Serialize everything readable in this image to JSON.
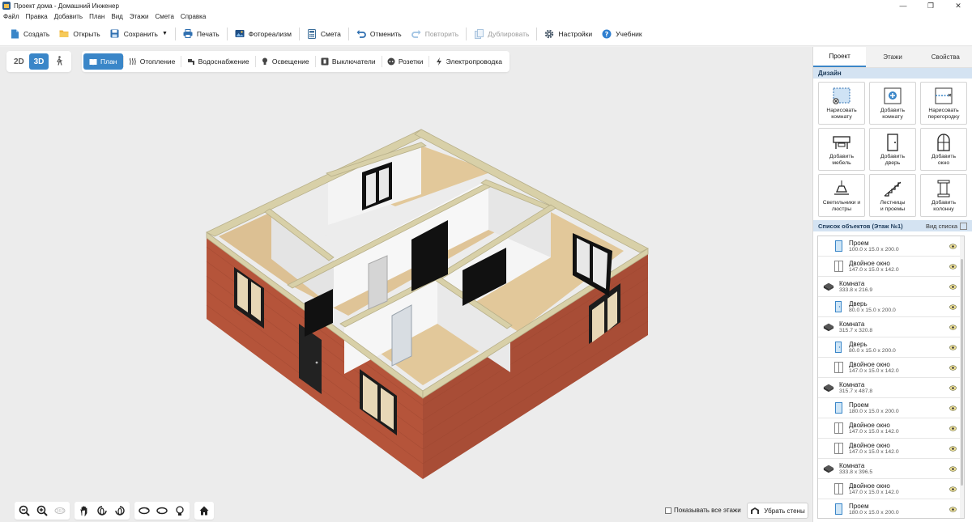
{
  "window": {
    "title": "Проект дома - Домашний Инженер",
    "controls": {
      "minimize": "—",
      "maximize": "❐",
      "close": "✕"
    }
  },
  "menu": [
    "Файл",
    "Правка",
    "Добавить",
    "План",
    "Вид",
    "Этажи",
    "Смета",
    "Справка"
  ],
  "toolbar": {
    "create": "Создать",
    "open": "Открыть",
    "save": "Сохранить",
    "print": "Печать",
    "photorealism": "Фотореализм",
    "estimate": "Смета",
    "undo": "Отменить",
    "redo": "Повторить",
    "duplicate": "Дублировать",
    "settings": "Настройки",
    "tutorial": "Учебник"
  },
  "view_toggle": {
    "mode_2d": "2D",
    "mode_3d": "3D",
    "active": "3D"
  },
  "layers": {
    "active": "plan",
    "items": {
      "plan": "План",
      "heating": "Отопление",
      "water": "Водоснабжение",
      "lighting": "Освещение",
      "switches": "Выключатели",
      "sockets": "Розетки",
      "wiring": "Электропроводка"
    }
  },
  "bottom": {
    "show_all_floors": "Показывать все этажи",
    "show_all_checked": false,
    "remove_walls": "Убрать стены",
    "tool_icons": [
      "zoom-out-icon",
      "zoom-in-icon",
      "rotate-360-icon",
      "pan-hand-icon",
      "rotate-left-icon",
      "rotate-right-icon",
      "tilt-up-icon",
      "tilt-down-icon",
      "light-bulb-icon",
      "home-icon"
    ]
  },
  "panel": {
    "tabs": {
      "project": "Проект",
      "floors": "Этажи",
      "properties": "Свойства",
      "active": "Проект"
    },
    "design_header": "Дизайн",
    "design_items": [
      {
        "label": "Нарисовать\nкомнату",
        "icon": "draw-room-icon"
      },
      {
        "label": "Добавить\nкомнату",
        "icon": "add-room-icon"
      },
      {
        "label": "Нарисовать\nперегородку",
        "icon": "draw-partition-icon"
      },
      {
        "label": "Добавить\nмебель",
        "icon": "furniture-icon"
      },
      {
        "label": "Добавить\nдверь",
        "icon": "door-icon"
      },
      {
        "label": "Добавить\nокно",
        "icon": "window-icon"
      },
      {
        "label": "Светильники и\nлюстры",
        "icon": "lamp-icon"
      },
      {
        "label": "Лестницы\nи проемы",
        "icon": "stairs-icon"
      },
      {
        "label": "Добавить\nколонну",
        "icon": "column-icon"
      }
    ],
    "list_header": "Список объектов (Этаж №1)",
    "list_view": "Вид списка",
    "objects": [
      {
        "name": "Проем",
        "dims": "100.0 x 15.0 x 200.0",
        "type": "opening",
        "child": true
      },
      {
        "name": "Двойное окно",
        "dims": "147.0 x 15.0 x 142.0",
        "type": "window",
        "child": true
      },
      {
        "name": "Комната",
        "dims": "333.8 x 216.9",
        "type": "room",
        "child": false
      },
      {
        "name": "Дверь",
        "dims": "80.0 x 15.0 x 200.0",
        "type": "door",
        "child": true
      },
      {
        "name": "Комната",
        "dims": "315.7 x 320.8",
        "type": "room",
        "child": false
      },
      {
        "name": "Дверь",
        "dims": "80.0 x 15.0 x 200.0",
        "type": "door",
        "child": true
      },
      {
        "name": "Двойное окно",
        "dims": "147.0 x 15.0 x 142.0",
        "type": "window",
        "child": true
      },
      {
        "name": "Комната",
        "dims": "315.7 x 487.8",
        "type": "room",
        "child": false
      },
      {
        "name": "Проем",
        "dims": "180.0 x 15.0 x 200.0",
        "type": "opening",
        "child": true
      },
      {
        "name": "Двойное окно",
        "dims": "147.0 x 15.0 x 142.0",
        "type": "window",
        "child": true
      },
      {
        "name": "Двойное окно",
        "dims": "147.0 x 15.0 x 142.0",
        "type": "window",
        "child": true
      },
      {
        "name": "Комната",
        "dims": "333.8 x 396.5",
        "type": "room",
        "child": false
      },
      {
        "name": "Двойное окно",
        "dims": "147.0 x 15.0 x 142.0",
        "type": "window",
        "child": true
      },
      {
        "name": "Проем",
        "dims": "180.0 x 15.0 x 200.0",
        "type": "opening",
        "child": true
      }
    ]
  },
  "colors": {
    "accent": "#3a86c8",
    "brick": "#b5543a",
    "wall_top": "#d8d0a8",
    "floor": "#e2c89a",
    "interior_wall": "#f2f2f2"
  }
}
